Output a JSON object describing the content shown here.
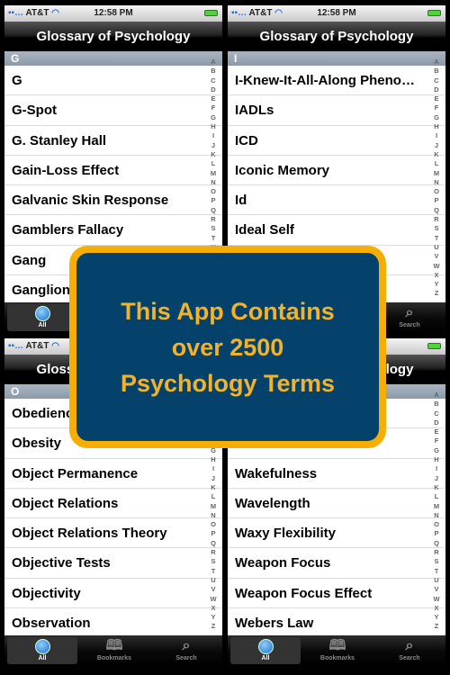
{
  "status": {
    "carrier": "AT&T",
    "time": "12:58 PM"
  },
  "nav_title": "Glossary of Psychology",
  "index_letters": [
    "A",
    "B",
    "C",
    "D",
    "E",
    "F",
    "G",
    "H",
    "I",
    "J",
    "K",
    "L",
    "M",
    "N",
    "O",
    "P",
    "Q",
    "R",
    "S",
    "T",
    "U",
    "V",
    "W",
    "X",
    "Y",
    "Z"
  ],
  "tabs": [
    {
      "label": "All",
      "icon": "globe-icon"
    },
    {
      "label": "Bookmarks",
      "icon": "book-icon"
    },
    {
      "label": "Search",
      "icon": "search-icon"
    }
  ],
  "screens": [
    {
      "section": "G",
      "rows": [
        "G",
        "G-Spot",
        "G. Stanley Hall",
        "Gain-Loss Effect",
        "Galvanic Skin Response",
        "Gamblers Fallacy",
        "Gang",
        "Ganglion"
      ]
    },
    {
      "section": "I",
      "rows": [
        "I-Knew-It-All-Along Phenomenon",
        "IADLs",
        "ICD",
        "Iconic Memory",
        "Id",
        "Ideal Self",
        "",
        ""
      ]
    },
    {
      "section": "O",
      "rows": [
        "Obedience",
        "Obesity",
        "Object Permanence",
        "Object Relations",
        "Object Relations Theory",
        "Objective Tests",
        "Objectivity",
        "Observation"
      ]
    },
    {
      "section": "",
      "rows": [
        "",
        "",
        "Wakefulness",
        "Wavelength",
        "Waxy Flexibility",
        "Weapon Focus",
        "Weapon Focus Effect",
        "Webers Law"
      ]
    }
  ],
  "promo": {
    "lines": [
      "This App Contains",
      "over 2500",
      "Psychology Terms"
    ],
    "bg": "#05426b",
    "border": "#f6ae07",
    "text": "#f2b22a"
  }
}
